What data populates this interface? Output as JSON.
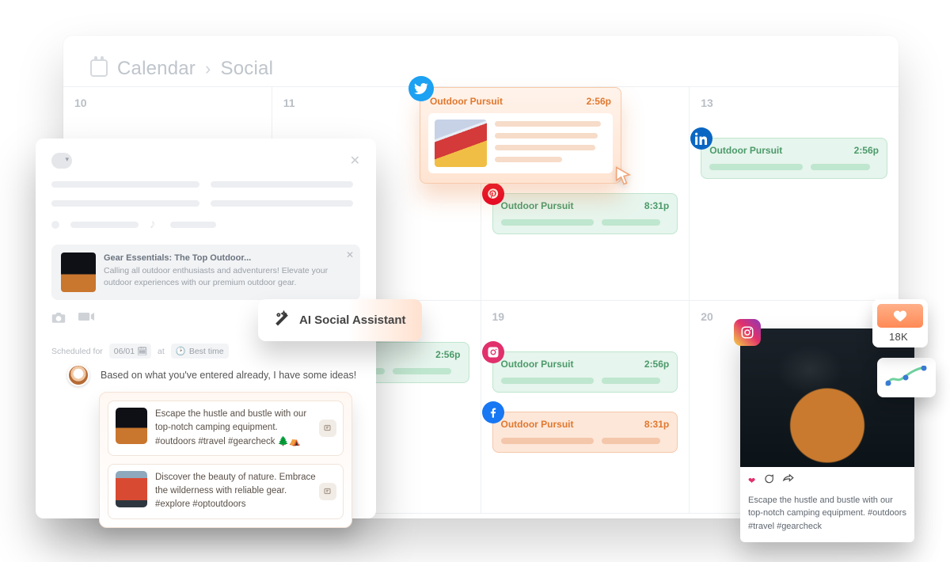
{
  "breadcrumb": {
    "root": "Calendar",
    "leaf": "Social"
  },
  "days": {
    "d10": "10",
    "d11": "11",
    "d13": "13",
    "d19": "19",
    "d20": "20"
  },
  "events": {
    "pursuit": "Outdoor Pursuit",
    "t256": "2:56p",
    "t831": "8:31p"
  },
  "composer": {
    "attach_title": "Gear Essentials: The Top Outdoor...",
    "attach_desc": "Calling all outdoor enthusiasts and adventurers! Elevate your outdoor experiences with our premium outdoor gear.",
    "sched_label": "Scheduled for",
    "sched_date": "06/01",
    "sched_at": "at",
    "sched_best": "Best time"
  },
  "ai": {
    "pill": "AI Social Assistant",
    "lead": "Based on what you've entered already, I have some ideas!",
    "sug1": "Escape the hustle and bustle with our top-notch camping equipment. #outdoors #travel #gearcheck 🌲⛺",
    "sug2": "Discover the beauty of nature. Embrace the wilderness with reliable gear. #explore #optoutdoors"
  },
  "ig": {
    "caption": "Escape the hustle and bustle with our top-notch camping equipment. #outdoors #travel #gearcheck"
  },
  "stats": {
    "likes": "18K"
  }
}
